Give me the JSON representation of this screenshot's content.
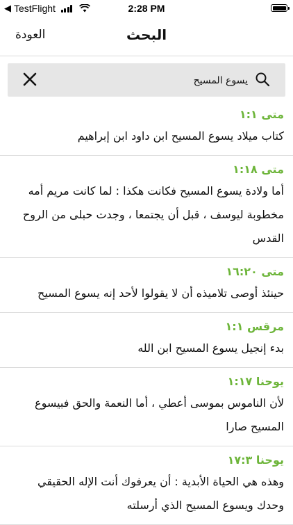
{
  "status": {
    "carrier": "TestFlight",
    "time": "2:28 PM"
  },
  "nav": {
    "title": "البحث",
    "back_label": "العودة"
  },
  "search": {
    "value": "يسوع المسيح"
  },
  "results": [
    {
      "ref": "متى ١:١",
      "text": "كتاب ميلاد يسوع المسيح ابن داود ابن إبراهيم"
    },
    {
      "ref": "متى ١:١٨",
      "text": "أما ولادة يسوع المسيح فكانت هكذا : لما كانت مريم أمه مخطوبة ليوسف ، قبل أن يجتمعا ، وجدت حبلى من الروح القدس"
    },
    {
      "ref": "متى ١٦:٢٠",
      "text": "حينئذ أوصى تلاميذه أن لا يقولوا لأحد إنه يسوع المسيح"
    },
    {
      "ref": "مرقس ١:١",
      "text": "بدء إنجيل يسوع المسيح ابن الله"
    },
    {
      "ref": "يوحنا ١:١٧",
      "text": "لأن الناموس بموسى أعطي ، أما النعمة والحق فبيسوع المسيح صارا"
    },
    {
      "ref": "يوحنا ١٧:٣",
      "text": "وهذه هي الحياة الأبدية : أن يعرفوك أنت الإله الحقيقي وحدك ويسوع المسيح الذي أرسلته"
    }
  ]
}
